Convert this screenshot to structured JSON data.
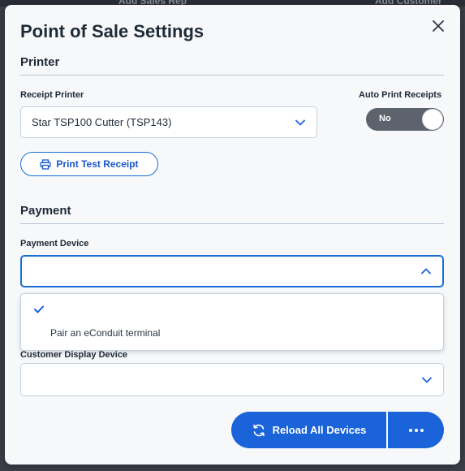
{
  "background": {
    "ghost_left": "Add Sales Rep",
    "ghost_right": "Add Customer"
  },
  "modal": {
    "title": "Point of Sale Settings"
  },
  "printer": {
    "heading": "Printer",
    "receipt_printer_label": "Receipt Printer",
    "receipt_printer_value": "Star TSP100 Cutter (TSP143)",
    "auto_print_label": "Auto Print Receipts",
    "auto_print_value": "No",
    "test_button_label": "Print Test Receipt"
  },
  "payment": {
    "heading": "Payment",
    "device_label": "Payment Device",
    "device_value": "",
    "options": [
      {
        "label": "",
        "checked": true
      },
      {
        "label": "Pair an eConduit terminal",
        "checked": false
      }
    ]
  },
  "customer_display": {
    "label": "Customer Display Device",
    "value": ""
  },
  "footer": {
    "reload_label": "Reload All Devices",
    "more_label": "More options"
  },
  "colors": {
    "accent": "#1a63d8",
    "toggle_off": "#5d636c",
    "title_text": "#1f2a37"
  }
}
